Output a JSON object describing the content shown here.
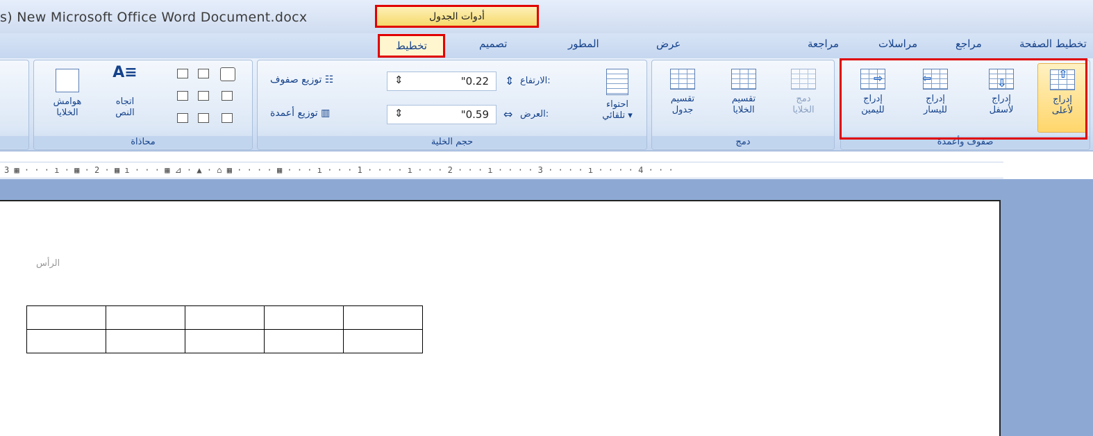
{
  "title_bar": {
    "doc_title": "s) New Microsoft Office Word Document.docx",
    "context_tab": "أدوات الجدول"
  },
  "tabs": [
    {
      "label": "تخطيط الصفحة"
    },
    {
      "label": "مراجع"
    },
    {
      "label": "مراسلات"
    },
    {
      "label": "مراجعة"
    },
    {
      "label": "عرض"
    },
    {
      "label": "المطور"
    },
    {
      "label": "تصميم"
    },
    {
      "label": "تخطيط"
    }
  ],
  "groups": {
    "rows_cols": {
      "label": "صفوف وأعمدة",
      "insert_above": [
        "إدراج",
        "لأعلى"
      ],
      "insert_below": [
        "إدراج",
        "لأسفل"
      ],
      "insert_left": [
        "إدراج",
        "لليسار"
      ],
      "insert_right": [
        "إدراج",
        "لليمين"
      ]
    },
    "merge": {
      "label": "دمج",
      "merge_cells": [
        "دمج",
        "الخلايا"
      ],
      "split_cells": [
        "تقسيم",
        "الخلايا"
      ],
      "split_table": [
        "تقسيم",
        "جدول"
      ]
    },
    "cell_size": {
      "label": "حجم الخلية",
      "autofit": [
        "احتواء",
        "تلقائي ▾"
      ],
      "height_label": "الارتفاع:",
      "height_value": "\"0.22",
      "width_label": "العرض:",
      "width_value": "\"0.59",
      "dist_rows": "توزيع صفوف",
      "dist_cols": "توزيع أعمدة"
    },
    "alignment": {
      "label": "محاذاة",
      "text_direction": [
        "اتجاه",
        "النص"
      ],
      "cell_margins": [
        "هوامش",
        "الخلايا"
      ]
    }
  },
  "ruler": "3 ▦ · · · ı · ▦ · 2 · ▦ ı · · · ▦ ⊿ · ▲ · ⌂ ▦ · · · · ▦ · · · ı · · · 1 · · · · ı · · · 2 · · · ı · · · · 3 · · · · ı · · · · 4 · · ·",
  "document": {
    "header_text": "الرأس"
  },
  "colors": {
    "ribbon": "#d6e3f5",
    "highlight": "#e00000",
    "accent_tab": "#fff6cf",
    "workspace": "#8da9d3"
  }
}
